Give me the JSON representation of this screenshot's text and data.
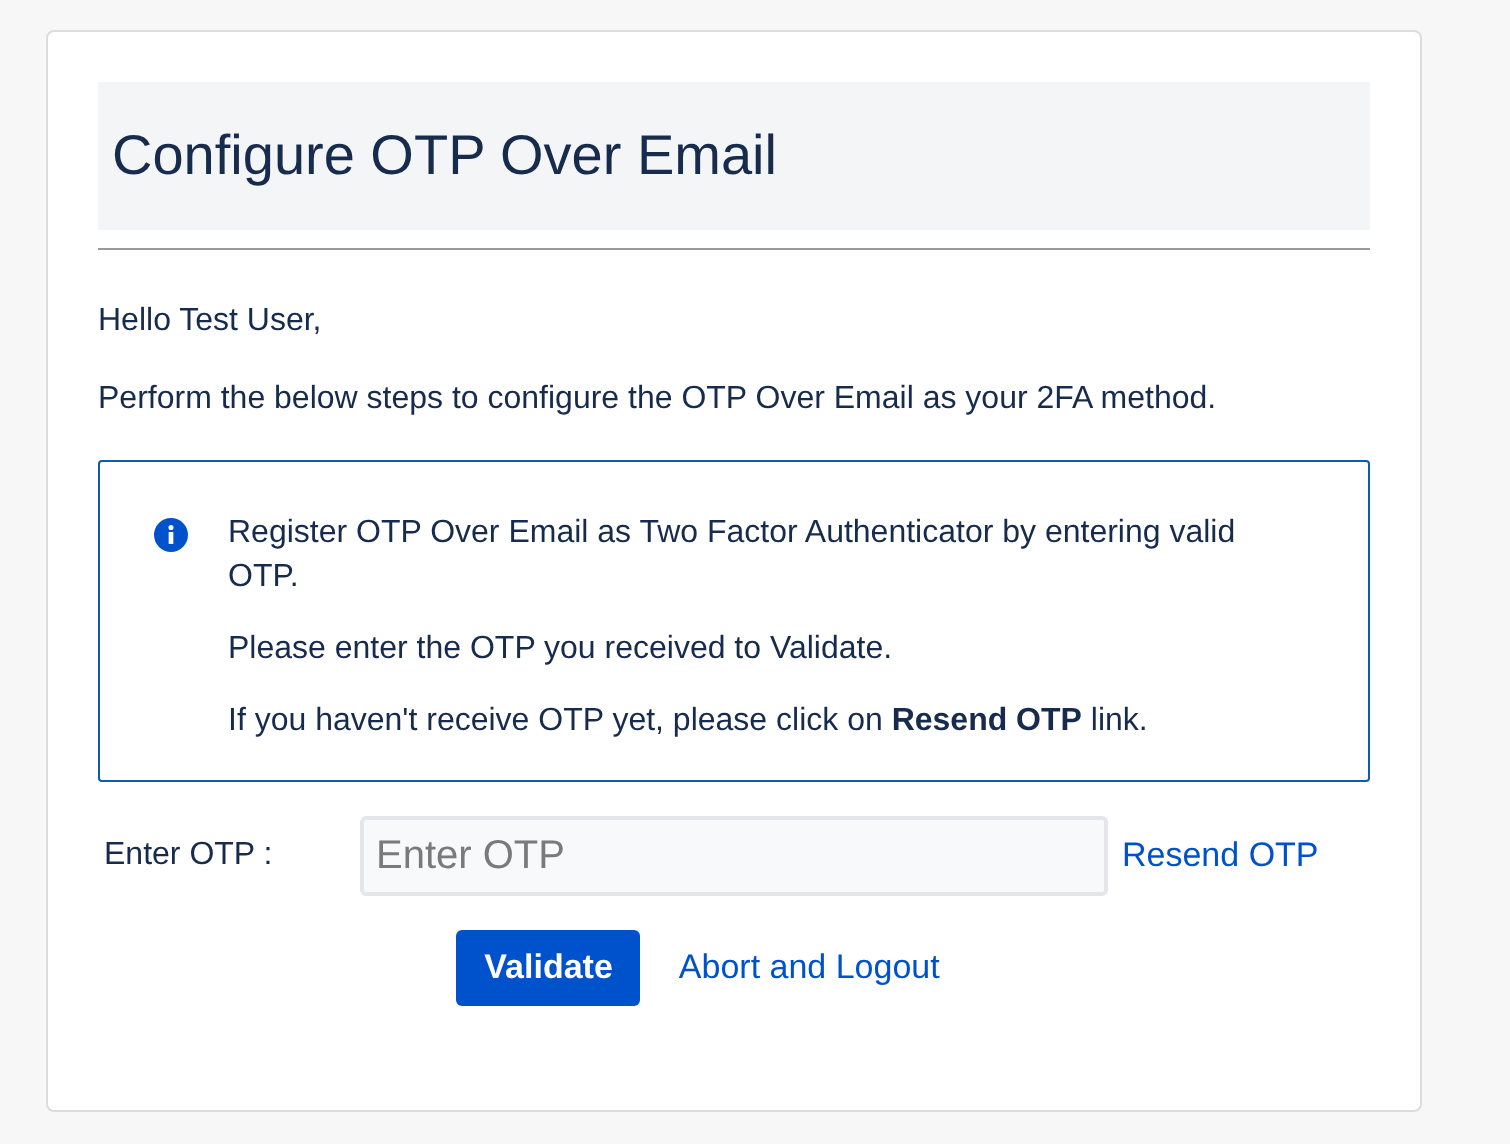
{
  "title": "Configure OTP Over Email",
  "greeting": "Hello Test User,",
  "intro": "Perform the below steps to configure the OTP Over Email as your 2FA method.",
  "info_box": {
    "lines": [
      "Register OTP Over Email as Two Factor Authenticator by entering valid OTP.",
      "Please enter the OTP you received to Validate.",
      "If you haven't receive OTP yet, please click on **Resend OTP** link."
    ]
  },
  "otp_field": {
    "label": "Enter OTP :",
    "placeholder": "Enter OTP"
  },
  "resend_link": "Resend OTP",
  "validate_button": "Validate",
  "abort_link": "Abort and Logout"
}
